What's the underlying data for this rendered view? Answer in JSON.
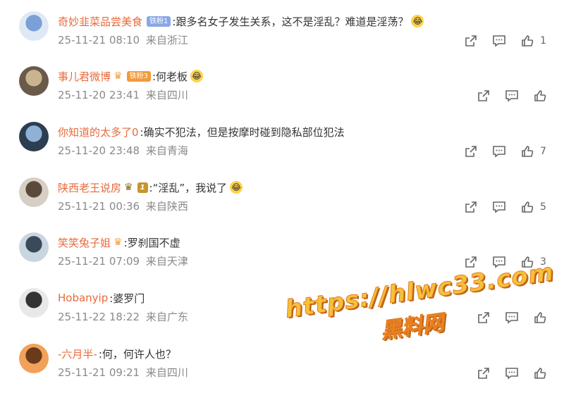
{
  "comments": [
    {
      "user": "奇妙韭菜品尝美食",
      "badge": "铁粉1",
      "badge_type": "blue",
      "text": ":跟多名女子发生关系，这不是淫乱？难道是淫荡？",
      "emoji": "😂",
      "time": "25-11-21 08:10",
      "location": "来自浙江",
      "likes": "1"
    },
    {
      "user": "事儿君微博",
      "badge": "铁粉3",
      "badge_type": "crown",
      "text": ":何老板",
      "emoji": "😂",
      "time": "25-11-20 23:41",
      "location": "来自四川",
      "likes": ""
    },
    {
      "user": "你知道的太多了0",
      "badge": "",
      "badge_type": "",
      "text": ":确实不犯法，但是按摩时碰到隐私部位犯法",
      "emoji": "",
      "time": "25-11-20 23:48",
      "location": "来自青海",
      "likes": "7"
    },
    {
      "user": "陕西老王说房",
      "badge": "1",
      "badge_type": "gold",
      "text": ":“淫乱”，我说了",
      "emoji": "😂",
      "time": "25-11-21 00:36",
      "location": "来自陕西",
      "likes": "5"
    },
    {
      "user": "笑笑兔子姐",
      "badge": "",
      "badge_type": "crown-only",
      "text": ":罗刹国不虚",
      "emoji": "",
      "time": "25-11-21 07:09",
      "location": "来自天津",
      "likes": "3"
    },
    {
      "user": "Hobanyip",
      "badge": "",
      "badge_type": "",
      "text": ":婆罗门",
      "emoji": "",
      "time": "25-11-22 18:22",
      "location": "来自广东",
      "likes": ""
    },
    {
      "user": "-六月半-",
      "badge": "",
      "badge_type": "",
      "text": ":何，何许人也？",
      "emoji": "",
      "time": "25-11-21 09:21",
      "location": "来自四川",
      "likes": ""
    }
  ],
  "watermark": {
    "line1": "https://hlwc33.com",
    "line2": "黑料网"
  },
  "colors": {
    "username": "#e8693a",
    "meta": "#8a8a8a",
    "icon": "#666666"
  }
}
